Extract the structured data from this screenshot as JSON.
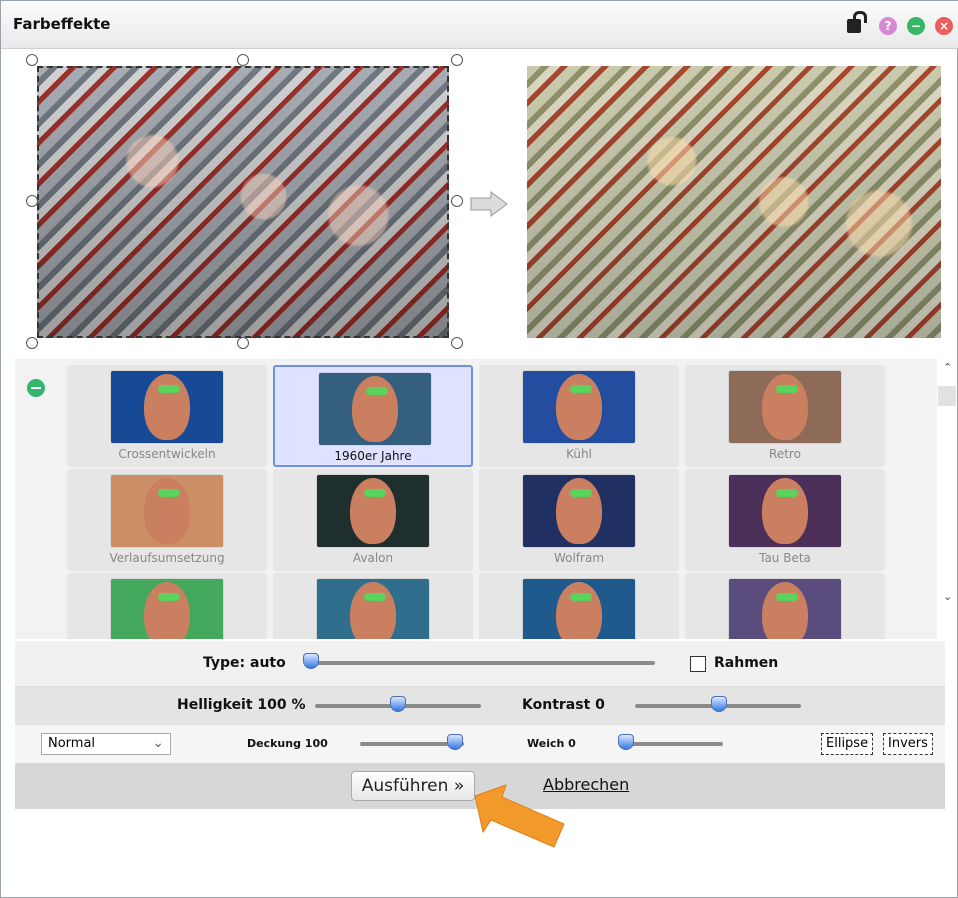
{
  "window": {
    "title": "Farbeffekte"
  },
  "effects": [
    {
      "label": "Crossentwickeln"
    },
    {
      "label": "1960er Jahre",
      "selected": true
    },
    {
      "label": "Kühl"
    },
    {
      "label": "Retro"
    },
    {
      "label": "Verlaufsumsetzung"
    },
    {
      "label": "Avalon"
    },
    {
      "label": "Wolfram"
    },
    {
      "label": "Tau Beta"
    },
    {
      "label": ""
    },
    {
      "label": ""
    },
    {
      "label": ""
    },
    {
      "label": ""
    }
  ],
  "controls": {
    "type_label": "Type: auto",
    "rahmen_label": "Rahmen",
    "helligkeit_label": "Helligkeit 100 %",
    "kontrast_label": "Kontrast 0",
    "blend_mode": "Normal",
    "deckung_label": "Deckung 100",
    "weich_label": "Weich 0",
    "ellipse_label": "Ellipse",
    "invers_label": "Invers"
  },
  "footer": {
    "execute_label": "Ausführen »",
    "cancel_label": "Abbrechen"
  }
}
